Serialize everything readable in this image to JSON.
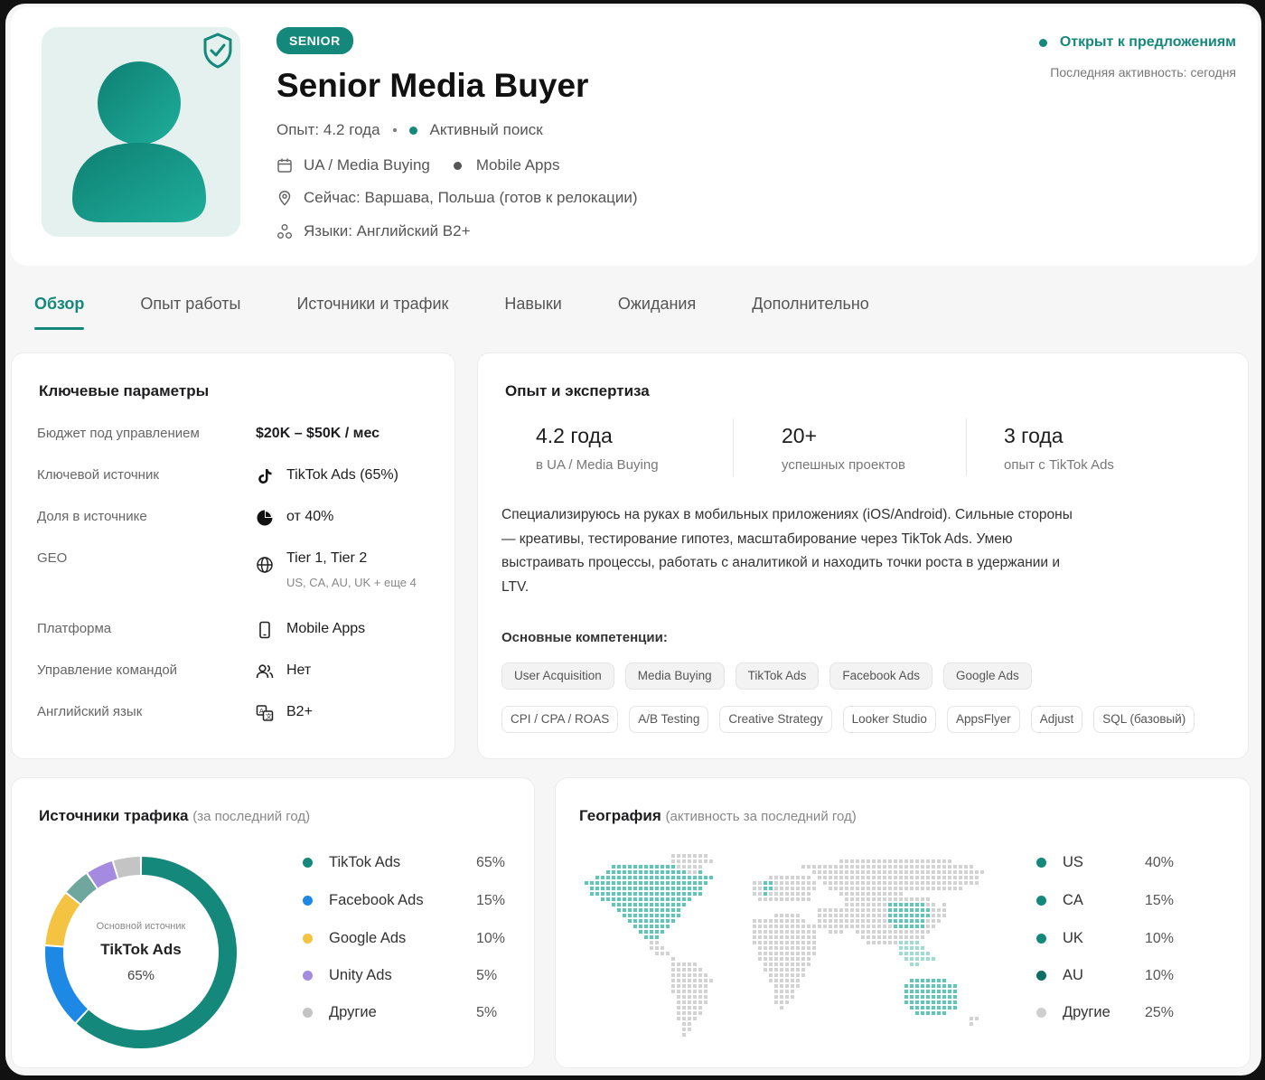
{
  "header": {
    "badge": "SENIOR",
    "title": "Senior Media Buyer",
    "experience": "Опыт: 4.2 года",
    "search_status": "Активный поиск",
    "specialization": "UA / Media Buying",
    "vertical": "Mobile Apps",
    "location": "Сейчас: Варшава, Польша (готов к релокации)",
    "languages": "Языки: Английский B2+",
    "status": "Открыт к предложениям",
    "last_activity": "Последняя активность: сегодня",
    "accent_color": "#14897b"
  },
  "tabs": [
    {
      "label": "Обзор",
      "active": true
    },
    {
      "label": "Опыт работы"
    },
    {
      "label": "Источники и трафик"
    },
    {
      "label": "Навыки"
    },
    {
      "label": "Ожидания"
    },
    {
      "label": "Дополнительно"
    }
  ],
  "key_params": {
    "title": "Ключевые параметры",
    "rows": [
      {
        "label": "Бюджет под управлением",
        "value": "$20K – $50K / мес",
        "icon": ""
      },
      {
        "label": "Ключевой источник",
        "value": "TikTok Ads (65%)",
        "icon": "tiktok-icon"
      },
      {
        "label": "Доля в источнике",
        "value": "от 40%",
        "icon": "pie-icon"
      },
      {
        "label": "GEO",
        "value": "Tier 1, Tier 2",
        "sub": "US, CA, AU, UK + еще 4",
        "icon": "globe-icon"
      },
      {
        "label": "Платформа",
        "value": "Mobile Apps",
        "icon": "phone-icon"
      },
      {
        "label": "Управление командой",
        "value": "Нет",
        "icon": "users-icon"
      },
      {
        "label": "Английский язык",
        "value": "B2+",
        "icon": "translate-icon"
      }
    ]
  },
  "expertise": {
    "title": "Опыт и экспертиза",
    "stats": [
      {
        "num": "4.2 года",
        "label": "в UA / Media Buying"
      },
      {
        "num": "20+",
        "label": "успешных проектов"
      },
      {
        "num": "3 года",
        "label": "опыт с TikTok Ads"
      }
    ],
    "description": "Специализируюсь на руках в мобильных приложениях (iOS/Android). Сильные стороны — креативы, тестирование гипотез, масштабирование через TikTok Ads. Умею выстраивать процессы, работать с аналитикой и находить точки роста в удержании и LTV.",
    "competencies_title": "Основные компетенции:",
    "chips_row1": [
      "User Acquisition",
      "Media Buying",
      "TikTok Ads",
      "Facebook Ads",
      "Google Ads"
    ],
    "chips_row2": [
      "CPI / CPA / ROAS",
      "A/B Testing",
      "Creative Strategy",
      "Looker Studio",
      "AppsFlyer",
      "Adjust",
      "SQL (базовый)"
    ]
  },
  "traffic": {
    "title": "Источники трафика",
    "subtitle": "(за последний год)",
    "center_caption": "Основной источник",
    "center_name": "TikTok Ads",
    "center_value": "65%",
    "items": [
      {
        "name": "TikTok Ads",
        "value": "65%",
        "pct": 65,
        "color": "#14897b"
      },
      {
        "name": "Facebook Ads",
        "value": "15%",
        "pct": 15,
        "color": "#1e88e5"
      },
      {
        "name": "Google Ads",
        "value": "10%",
        "pct": 10,
        "color": "#f5c342"
      },
      {
        "name": "Unity Ads",
        "value": "5%",
        "pct": 5,
        "color": "#a58be0"
      },
      {
        "name": "Другие",
        "value": "5%",
        "pct": 5,
        "color": "#c4c4c4"
      }
    ],
    "donut_extra_colors": [
      "#6fa79e"
    ]
  },
  "geography": {
    "title": "География",
    "subtitle": "(активность за последний год)",
    "items": [
      {
        "name": "US",
        "value": "40%",
        "color": "#14897b"
      },
      {
        "name": "CA",
        "value": "15%",
        "color": "#14897b"
      },
      {
        "name": "UK",
        "value": "10%",
        "color": "#14897b"
      },
      {
        "name": "AU",
        "value": "10%",
        "color": "#0f6f63"
      },
      {
        "name": "Другие",
        "value": "25%",
        "color": "#cfcfcf"
      }
    ]
  }
}
